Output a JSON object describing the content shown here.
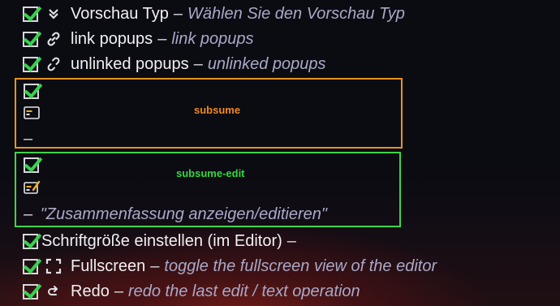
{
  "items": [
    {
      "label": "Vorschau Typ",
      "dash": "–",
      "desc": "Wählen Sie den Vorschau Typ",
      "icon": "chevron-double-down-icon"
    },
    {
      "label": "link popups",
      "dash": "–",
      "desc": "link popups",
      "icon": "link-icon"
    },
    {
      "label": "unlinked popups",
      "dash": "–",
      "desc": "unlinked popups",
      "icon": "unlink-icon"
    }
  ],
  "subsume": {
    "title": "subsume",
    "dash": "–",
    "icon": "summary-icon",
    "color": "#e7931f"
  },
  "subsume_edit": {
    "title": "subsume-edit",
    "dash": "–",
    "desc": "\"Zusammenfassung anzeigen/editieren\"",
    "icon": "summary-edit-icon",
    "color": "#3ad64a"
  },
  "items_bottom": [
    {
      "label": "Schriftgröße einstellen (im Editor)",
      "dash": "–"
    },
    {
      "label": "Fullscreen",
      "dash": "–",
      "desc": "toggle the fullscreen view of the editor",
      "icon": "fullscreen-icon"
    },
    {
      "label": "Redo",
      "dash": "–",
      "desc": "redo the last edit / text operation",
      "icon": "redo-icon"
    }
  ],
  "colors": {
    "check": "#37d24e",
    "description": "#a9a9c8"
  }
}
